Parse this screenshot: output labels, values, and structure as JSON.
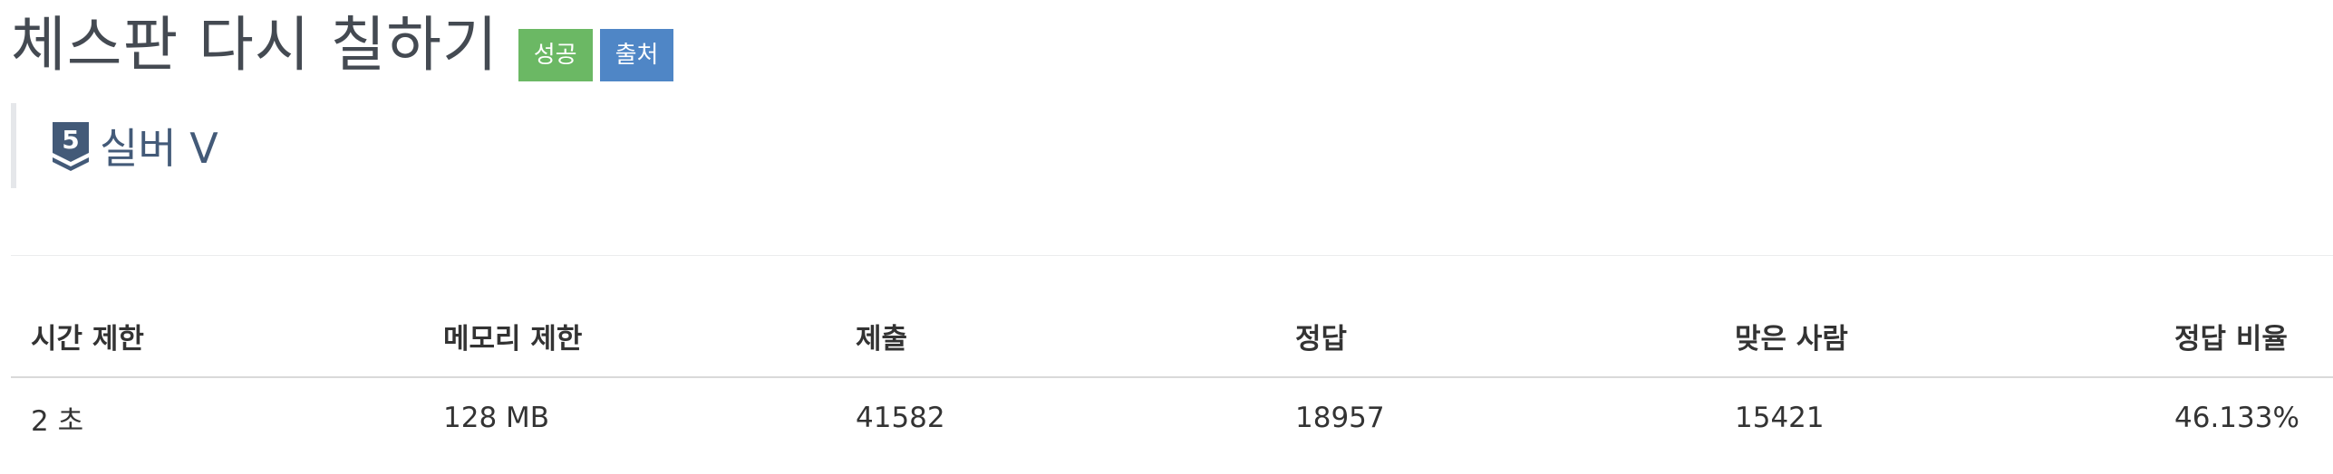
{
  "problem": {
    "title": "체스판 다시 칠하기",
    "badges": [
      {
        "label": "성공",
        "color": "#6bb864"
      },
      {
        "label": "출처",
        "color": "#4f86c6"
      }
    ],
    "tier": {
      "number": "5",
      "label": "실버 V",
      "icon": "silver-tier-icon",
      "color": "#435a78"
    }
  },
  "stats_table": {
    "headers": [
      "시간 제한",
      "메모리 제한",
      "제출",
      "정답",
      "맞은 사람",
      "정답 비율"
    ],
    "rows": [
      [
        "2 초",
        "128 MB",
        "41582",
        "18957",
        "15421",
        "46.133%"
      ]
    ]
  }
}
